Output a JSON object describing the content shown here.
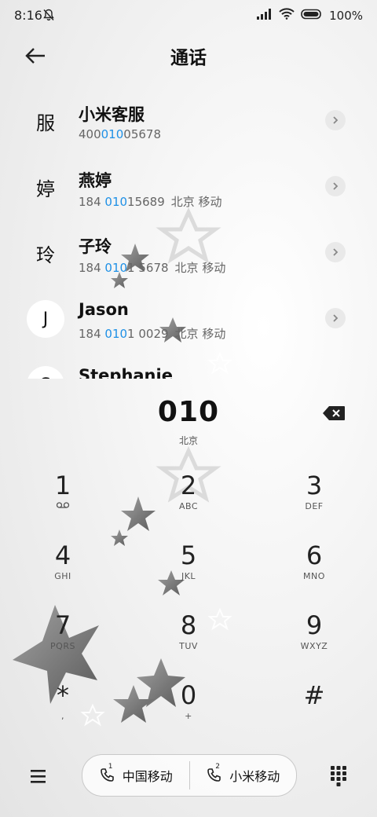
{
  "status_bar": {
    "time": "8:16",
    "battery": "100%"
  },
  "header": {
    "title": "通话"
  },
  "contacts": [
    {
      "avatar": "服",
      "name": "小米客服",
      "number_before": "400",
      "number_highlight": "010",
      "number_after": "05678",
      "location": ""
    },
    {
      "avatar": "婷",
      "name": "燕婷",
      "number_before": "184 ",
      "number_highlight": "010",
      "number_after": "15689",
      "location": "北京 移动"
    },
    {
      "avatar": "玲",
      "name": "子玲",
      "number_before": "184 ",
      "number_highlight": "010",
      "number_after": "1 5678",
      "location": "北京 移动"
    },
    {
      "avatar": "J",
      "name": "Jason",
      "number_before": "184 ",
      "number_highlight": "010",
      "number_after": "1 0029",
      "location": "北京 移动"
    },
    {
      "avatar": "S",
      "name": "Stephanie",
      "number_before": "",
      "number_highlight": "",
      "number_after": "",
      "location": ""
    }
  ],
  "dialpad": {
    "dialed_number": "010",
    "dialed_location": "北京",
    "keys": [
      {
        "digit": "1",
        "sub": ""
      },
      {
        "digit": "2",
        "sub": "ABC"
      },
      {
        "digit": "3",
        "sub": "DEF"
      },
      {
        "digit": "4",
        "sub": "GHI"
      },
      {
        "digit": "5",
        "sub": "JKL"
      },
      {
        "digit": "6",
        "sub": "MNO"
      },
      {
        "digit": "7",
        "sub": "PQRS"
      },
      {
        "digit": "8",
        "sub": "TUV"
      },
      {
        "digit": "9",
        "sub": "WXYZ"
      },
      {
        "digit": "*",
        "sub": ","
      },
      {
        "digit": "0",
        "sub": "+"
      },
      {
        "digit": "#",
        "sub": ""
      }
    ]
  },
  "call_buttons": [
    {
      "sim": "1",
      "label": "中国移动"
    },
    {
      "sim": "2",
      "label": "小米移动"
    }
  ],
  "colors": {
    "highlight": "#1e90e6",
    "text": "#111111",
    "background": "#f3f3f3"
  }
}
